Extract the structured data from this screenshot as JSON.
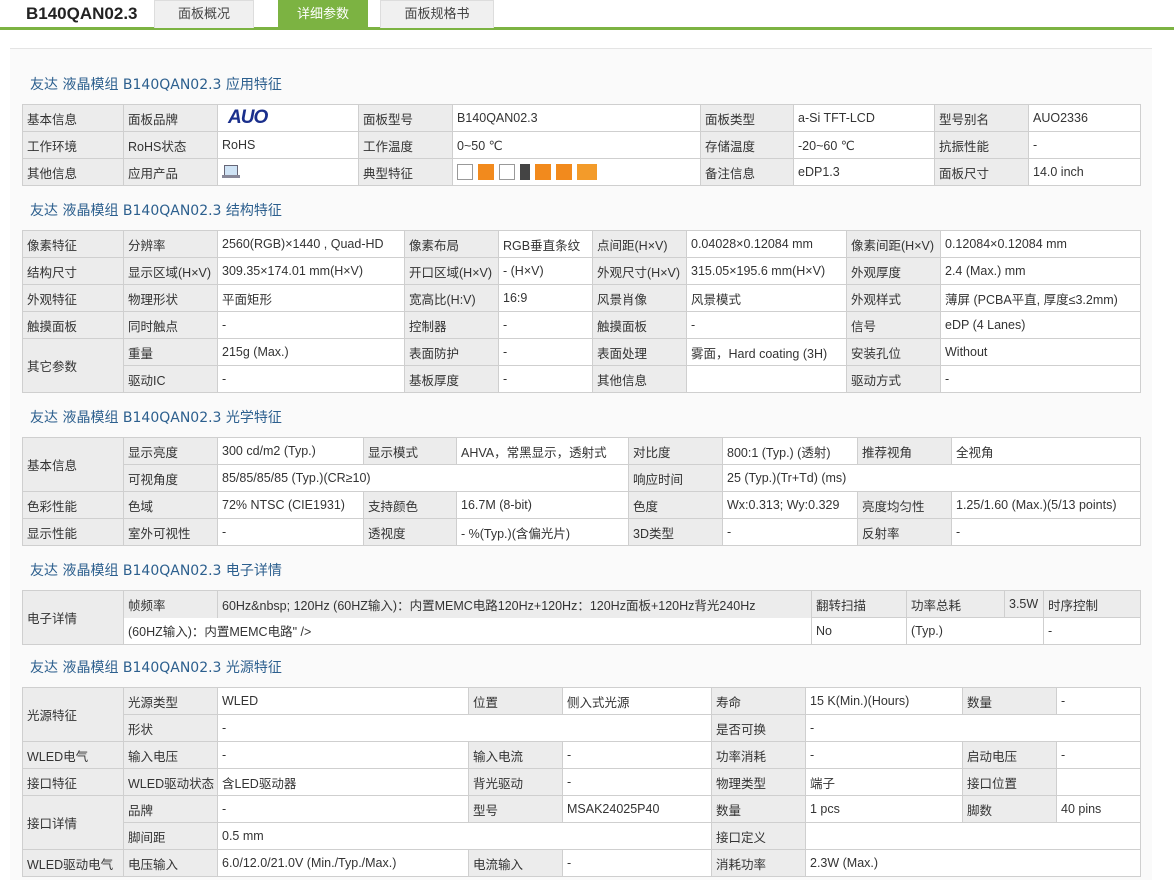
{
  "header": {
    "model": "B140QAN02.3",
    "tabs": [
      {
        "label": "面板概况"
      },
      {
        "label": "详细参数"
      },
      {
        "label": "面板规格书"
      }
    ]
  },
  "brand_logo_text": "AUO",
  "colors": {
    "accent": "#7cb342",
    "title": "#2c5f8e"
  },
  "sections": [
    {
      "title": "友达 液晶模组 B140QAN02.3 应用特征"
    },
    {
      "title": "友达 液晶模组 B140QAN02.3 结构特征"
    },
    {
      "title": "友达 液晶模组 B140QAN02.3 光学特征"
    },
    {
      "title": "友达 液晶模组 B140QAN02.3 电子详情"
    },
    {
      "title": "友达 液晶模组 B140QAN02.3 光源特征"
    }
  ],
  "app": {
    "r0": [
      "基本信息",
      "面板品牌",
      "",
      "面板型号",
      "B140QAN02.3",
      "面板类型",
      "a-Si TFT-LCD",
      "型号别名",
      "AUO2336"
    ],
    "r1": [
      "工作环境",
      "RoHS状态",
      "RoHS",
      "工作温度",
      "0~50 ℃",
      "存储温度",
      "-20~60 ℃",
      "抗振性能",
      "-"
    ],
    "r2": [
      "其他信息",
      "应用产品",
      "",
      "典型特征",
      "",
      "备注信息",
      "eDP1.3",
      "面板尺寸",
      "14.0 inch"
    ]
  },
  "struct": {
    "r0": [
      "像素特征",
      "分辨率",
      "2560(RGB)×1440 , Quad-HD",
      "像素布局",
      "RGB垂直条纹",
      "点间距(H×V)",
      "0.04028×0.12084 mm",
      "像素间距(H×V)",
      "0.12084×0.12084 mm"
    ],
    "r1": [
      "结构尺寸",
      "显示区域(H×V)",
      "309.35×174.01 mm(H×V)",
      "开口区域(H×V)",
      "- (H×V)",
      "外观尺寸(H×V)",
      "315.05×195.6 mm(H×V)",
      "外观厚度",
      "2.4 (Max.) mm"
    ],
    "r2": [
      "外观特征",
      "物理形状",
      "平面矩形",
      "宽高比(H:V)",
      "16:9",
      "风景肖像",
      "风景模式",
      "外观样式",
      "薄屏 (PCBA平直, 厚度≤3.2mm)"
    ],
    "r3": [
      "触摸面板",
      "同时触点",
      "-",
      "控制器",
      "-",
      "触摸面板",
      "-",
      "信号",
      "eDP (4 Lanes)"
    ],
    "r4": [
      "其它参数",
      "重量",
      "215g (Max.)",
      "表面防护",
      "-",
      "表面处理",
      "雾面，Hard coating (3H)",
      "安装孔位",
      "Without"
    ],
    "r5": [
      "驱动IC",
      "-",
      "基板厚度",
      "-",
      "其他信息",
      "",
      "驱动方式",
      "-"
    ]
  },
  "optical": {
    "r0": [
      "基本信息",
      "显示亮度",
      "300 cd/m2 (Typ.)",
      "显示模式",
      "AHVA，常黑显示，透射式",
      "对比度",
      "800:1 (Typ.) (透射)",
      "推荐视角",
      "全视角"
    ],
    "r1": [
      "可视角度",
      "85/85/85/85 (Typ.)(CR≥10)",
      "响应时间",
      "25 (Typ.)(Tr+Td) (ms)"
    ],
    "r2": [
      "色彩性能",
      "色域",
      "72% NTSC (CIE1931)",
      "支持颜色",
      "16.7M (8-bit)",
      "色度",
      "Wx:0.313; Wy:0.329",
      "亮度均匀性",
      "1.25/1.60 (Max.)(5/13 points)"
    ],
    "r3": [
      "显示性能",
      "室外可视性",
      "-",
      "透视度",
      "- %(Typ.)(含偏光片)",
      "3D类型",
      "-",
      "反射率",
      "-"
    ]
  },
  "electrical": {
    "r0": [
      "电子详情",
      "帧频率",
      "60Hz&nbsp; 120Hz (60HZ输入)：内置MEMC电路120Hz+120Hz：120Hz面板+120Hz背光240Hz",
      "翻转扫描",
      "功率总耗",
      "3.5W",
      "时序控制"
    ],
    "r1": [
      "(60HZ输入)：内置MEMC电路\" />",
      "No",
      "(Typ.)",
      "-"
    ]
  },
  "light": {
    "r0": [
      "光源特征",
      "光源类型",
      "WLED",
      "位置",
      "侧入式光源",
      "寿命",
      "15 K(Min.)(Hours)",
      "数量",
      "-"
    ],
    "r1": [
      "形状",
      "-",
      "是否可换",
      "-"
    ],
    "r2": [
      "WLED电气",
      "输入电压",
      "-",
      "输入电流",
      "-",
      "功率消耗",
      "-",
      "启动电压",
      "-"
    ],
    "r3": [
      "接口特征",
      "WLED驱动状态",
      "含LED驱动器",
      "背光驱动",
      "-",
      "物理类型",
      "端子",
      "接口位置",
      ""
    ],
    "r4": [
      "接口详情",
      "品牌",
      "-",
      "型号",
      "MSAK24025P40",
      "数量",
      "1 pcs",
      "脚数",
      "40 pins"
    ],
    "r5": [
      "脚间距",
      "0.5 mm",
      "接口定义",
      ""
    ],
    "r6": [
      "WLED驱动电气",
      "电压输入",
      "6.0/12.0/21.0V (Min./Typ./Max.)",
      "电流输入",
      "-",
      "消耗功率",
      "2.3W (Max.)"
    ]
  }
}
